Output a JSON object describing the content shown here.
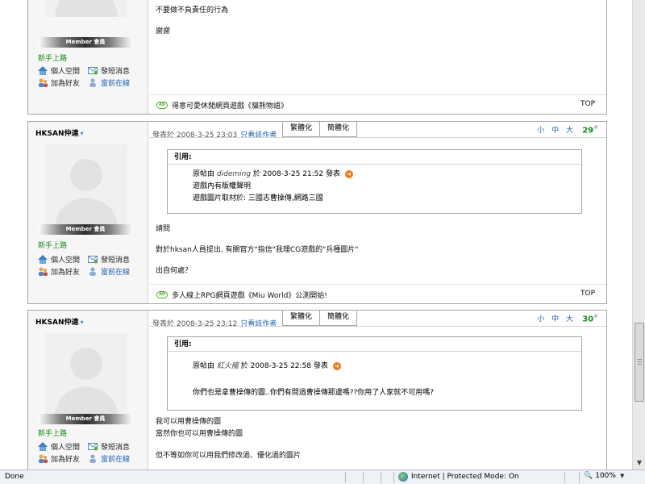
{
  "posts": [
    {
      "rank": "新手上路",
      "badge": "Member 會員",
      "links": {
        "space": "個人空間",
        "sms": "發短消息",
        "addfriend": "加為好友",
        "online": "當前在線"
      },
      "message": [
        "不要做不負責任的行為",
        "謝謝"
      ],
      "ad": "得意可愛休閒網頁遊戲《貓熊物語》",
      "top": "TOP"
    },
    {
      "username": "HKSAN仲達",
      "meta": "發表於 2008-3-25 23:03",
      "author_only": "只看該作者",
      "trad": "繁體化",
      "simp": "簡體化",
      "fontsize": "小 中 大",
      "floor": "29",
      "floor_sup": "#",
      "rank": "新手上路",
      "badge": "Member 會員",
      "links": {
        "space": "個人空間",
        "sms": "發短消息",
        "addfriend": "加為好友",
        "online": "當前在線"
      },
      "quote": {
        "title": "引用:",
        "line1_prefix": "原帖由",
        "line1_user": "dideming",
        "line1_suffix": "於 2008-3-25 21:52 發表",
        "line2": "遊戲內有版權聲明",
        "line3": "遊戲圖片取材於: 三國志曹操傳,網路三國"
      },
      "message": [
        "請問",
        "對於hksan人員提出, 有關官方\"指信\"我理CG遊戲的\"兵種圖片\"",
        "出自何處？"
      ],
      "ad": "多人線上RPG網頁遊戲《Miu World》公測開始!",
      "top": "TOP"
    },
    {
      "username": "HKSAN仲達",
      "meta": "發表於 2008-3-25 23:12",
      "author_only": "只看該作者",
      "trad": "繁體化",
      "simp": "簡體化",
      "fontsize": "小 中 大",
      "floor": "30",
      "floor_sup": "#",
      "rank": "新手上路",
      "badge": "Member 會員",
      "links": {
        "space": "個人空間",
        "sms": "發短消息",
        "addfriend": "加為好友",
        "online": "當前在線"
      },
      "quote": {
        "title": "引用:",
        "line1_prefix": "原帖由",
        "line1_user": "紅火龍",
        "line1_suffix": "於 2008-3-25 22:58 發表",
        "line2": "你們也是拿曹操傳的圖..你們有問過曹操傳那邊嗎??你用了人家就不可用嗎?"
      },
      "message": [
        "我可以用曹操傳的圖",
        "當然你也可以用曹操傳的圖",
        "但不等如你可以用我們修改過、優化過的圖片"
      ]
    }
  ],
  "statusbar": {
    "status": "Done",
    "zone": "Internet | Protected Mode: On",
    "zoom": "100%"
  },
  "colors": {
    "accent_link": "#1e5fb0",
    "rank_green": "#178a17",
    "border": "#a7a7a7"
  },
  "icons": [
    "home-icon",
    "mail-icon",
    "add-friend-icon",
    "online-user-icon",
    "reply-arrow-icon",
    "ad-icon",
    "globe-icon",
    "zoom-icon"
  ]
}
